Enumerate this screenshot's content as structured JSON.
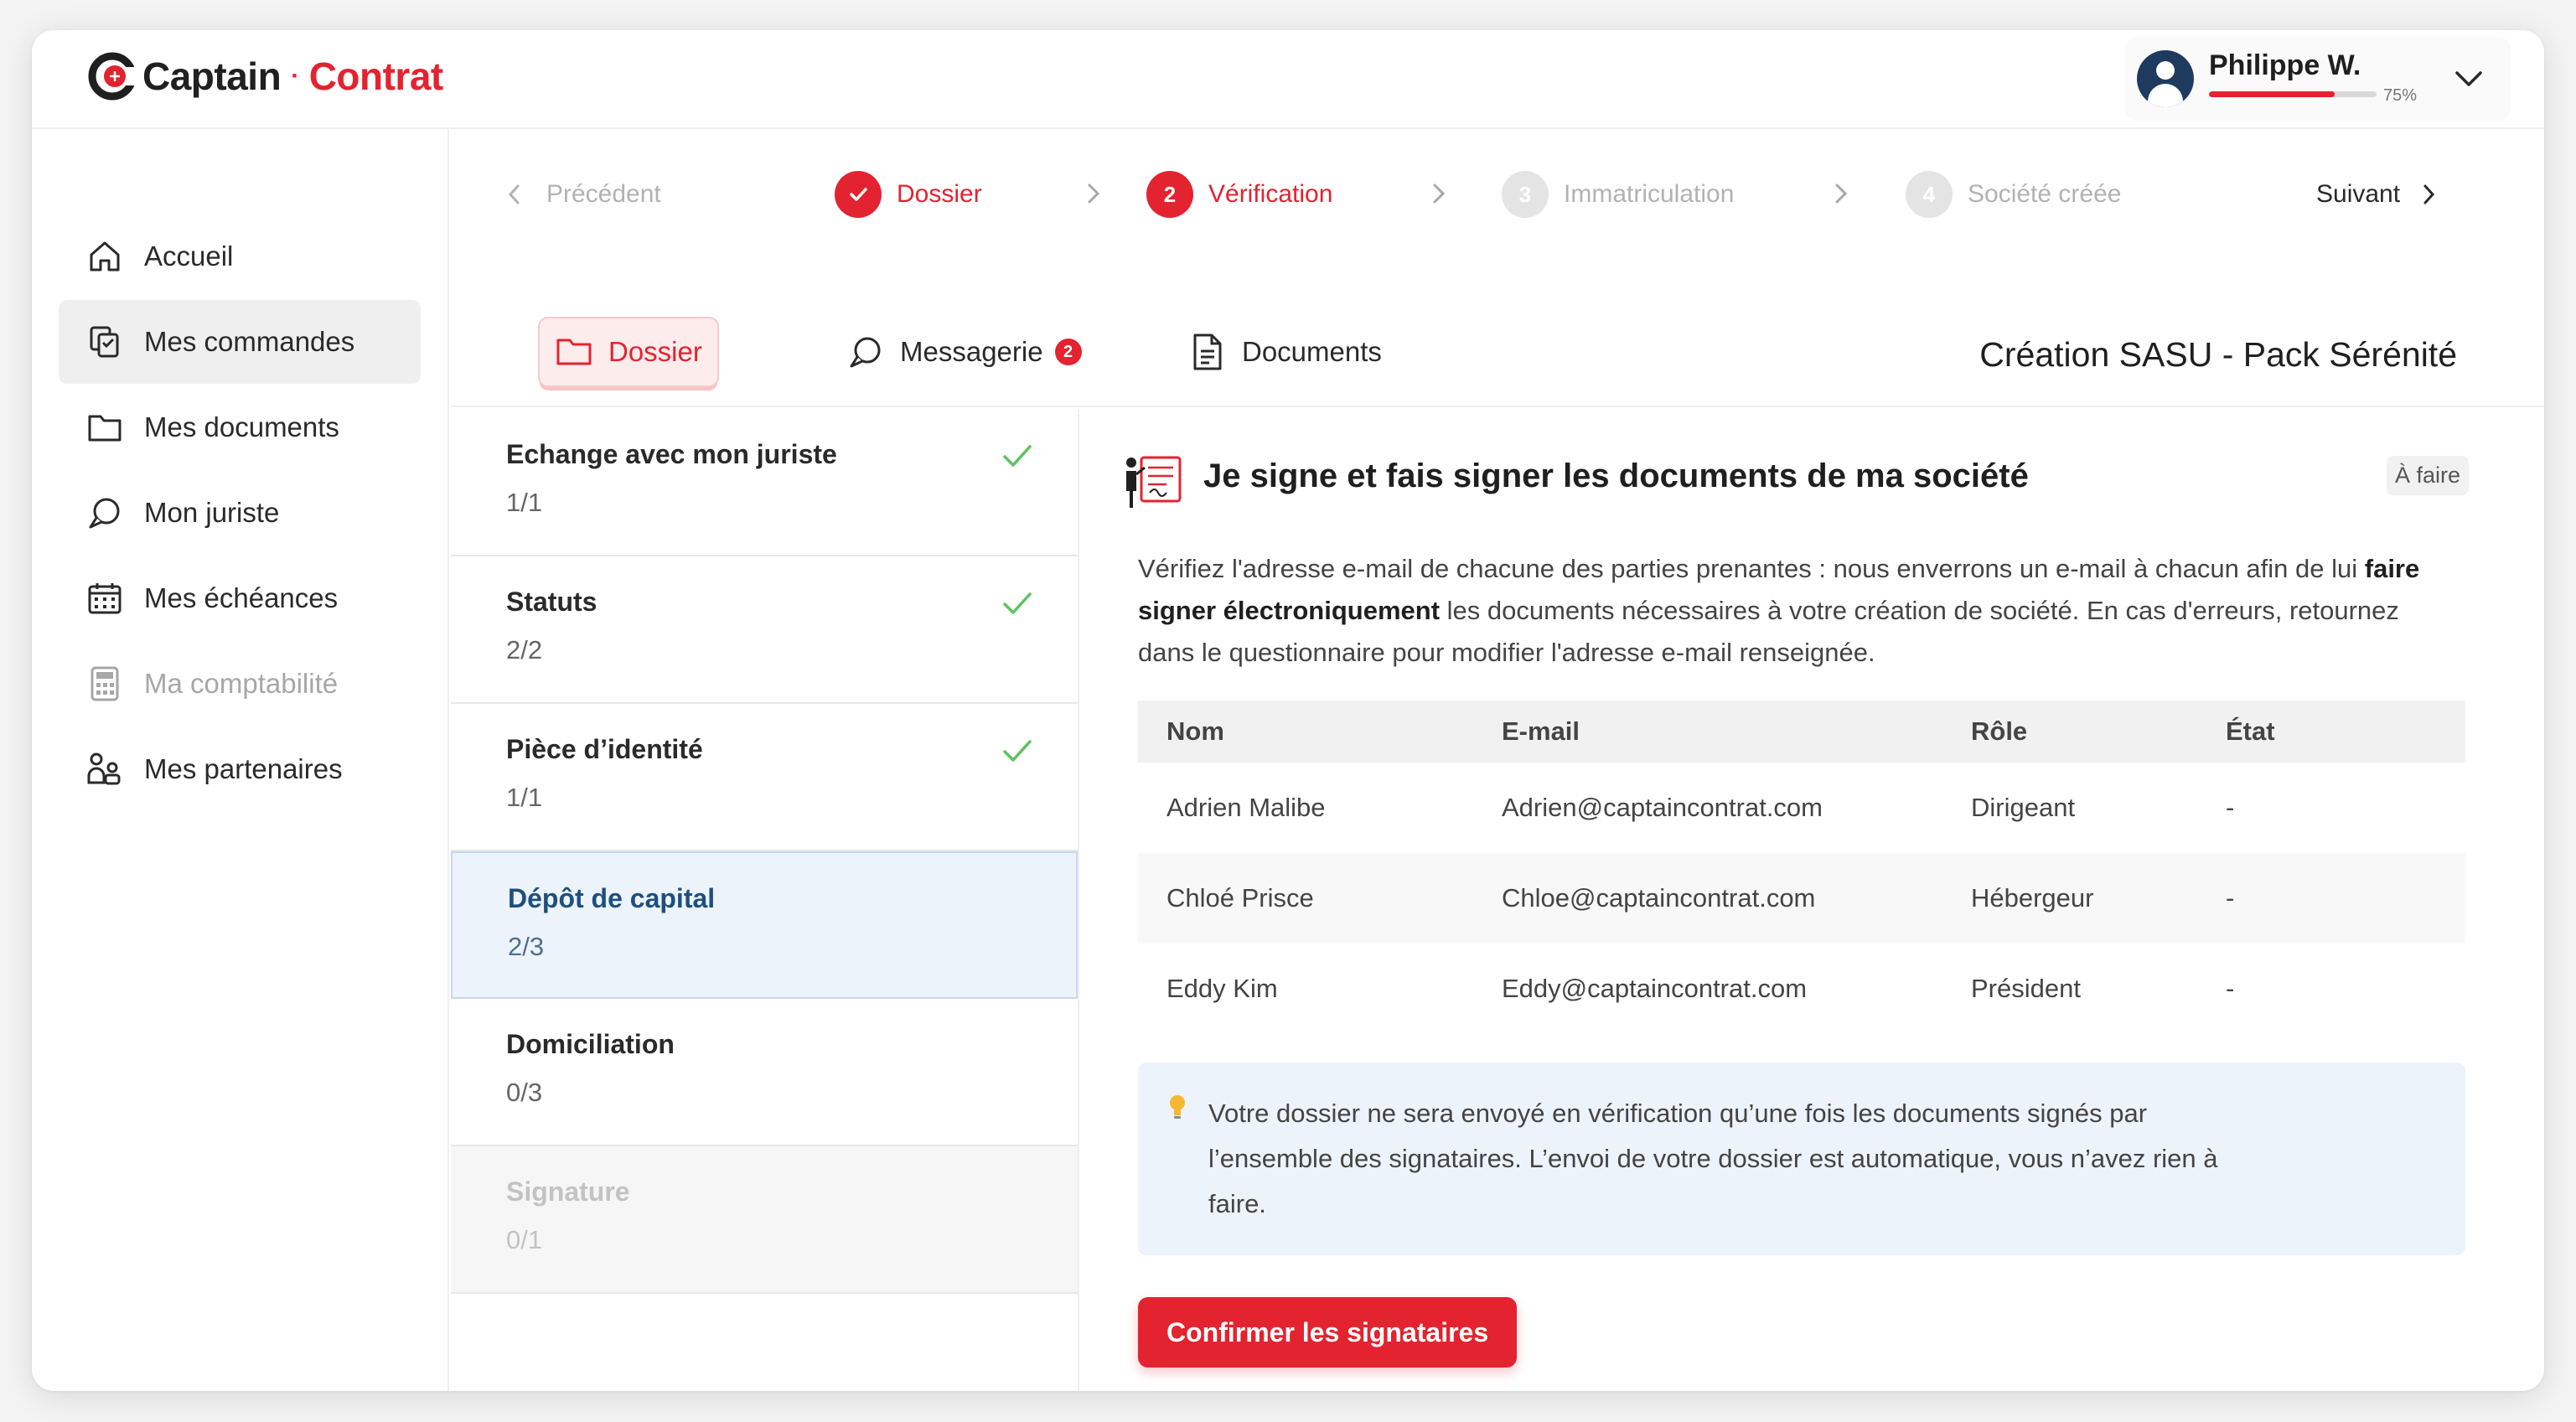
{
  "brand": {
    "name_left": "Captain",
    "separator": "·",
    "name_right": "Contrat",
    "accent": "#e3232f"
  },
  "user": {
    "name": "Philippe W.",
    "progress_label": "75%",
    "progress_value": 0.75
  },
  "sidebar": {
    "items": [
      {
        "label": "Accueil",
        "icon": "home-icon"
      },
      {
        "label": "Mes commandes",
        "icon": "orders-icon"
      },
      {
        "label": "Mes documents",
        "icon": "folder-icon"
      },
      {
        "label": "Mon juriste",
        "icon": "chat-icon"
      },
      {
        "label": "Mes échéances",
        "icon": "calendar-icon"
      },
      {
        "label": "Ma comptabilité",
        "icon": "calculator-icon"
      },
      {
        "label": "Mes partenaires",
        "icon": "partners-icon"
      }
    ]
  },
  "stepper": {
    "previous": "Précédent",
    "next": "Suivant",
    "steps": [
      {
        "num": "1",
        "label": "Dossier",
        "state": "done"
      },
      {
        "num": "2",
        "label": "Vérification",
        "state": "current"
      },
      {
        "num": "3",
        "label": "Immatriculation",
        "state": "upcoming"
      },
      {
        "num": "4",
        "label": "Société créée",
        "state": "upcoming"
      }
    ]
  },
  "tabs": [
    {
      "label": "Dossier",
      "icon": "folder-icon"
    },
    {
      "label": "Messagerie",
      "icon": "chat-icon",
      "badge": "2"
    },
    {
      "label": "Documents",
      "icon": "document-icon"
    }
  ],
  "page_title": "Création SASU - Pack Sérénité",
  "tasks": [
    {
      "title": "Echange avec mon juriste",
      "count": "1/1",
      "done": true
    },
    {
      "title": "Statuts",
      "count": "2/2",
      "done": true
    },
    {
      "title": "Pièce d’identité",
      "count": "1/1",
      "done": true
    },
    {
      "title": "Dépôt de capital",
      "count": "2/3",
      "done": false
    },
    {
      "title": "Domiciliation",
      "count": "0/3",
      "done": false
    },
    {
      "title": "Signature",
      "count": "0/1",
      "done": false
    }
  ],
  "panel": {
    "heading": "Je signe et fais signer les documents de ma société",
    "status_tag": "À faire",
    "intro_before": "Vérifiez l'adresse e-mail de chacune des parties prenantes : nous enverrons un e-mail à chacun afin de lui ",
    "intro_bold": "faire signer électroniquement",
    "intro_after": " les documents nécessaires à votre création de société. En cas d'erreurs, retournez dans le questionnaire pour modifier l'adresse e-mail renseignée.",
    "table": {
      "headers": [
        "Nom",
        "E-mail",
        "Rôle",
        "État"
      ],
      "rows": [
        [
          "Adrien Malibe",
          "Adrien@captaincontrat.com",
          "Dirigeant",
          "-"
        ],
        [
          "Chloé Prisce",
          "Chloe@captaincontrat.com",
          "Hébergeur",
          "-"
        ],
        [
          "Eddy Kim",
          "Eddy@captaincontrat.com",
          "Président",
          "-"
        ]
      ]
    },
    "info": "Votre dossier ne sera envoyé en vérification qu’une fois les documents signés par l’ensemble des signataires. L’envoi de votre dossier est automatique, vous n’avez rien à faire.",
    "confirm_label": "Confirmer les signataires"
  }
}
